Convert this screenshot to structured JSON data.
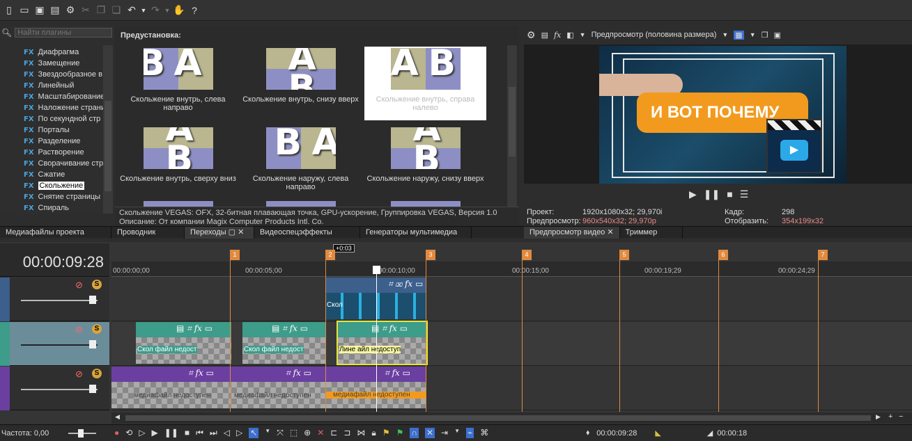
{
  "plugins": {
    "search_placeholder": "Найти плагины",
    "items": [
      "Диафрагма",
      "Замещение",
      "Звездообразное в",
      "Линейный",
      "Масштабирование",
      "Наложение страни",
      "По секундной стр",
      "Порталы",
      "Разделение",
      "Растворение",
      "Сворачивание стр",
      "Сжатие",
      "Скольжение",
      "Снятие страницы",
      "Спираль"
    ],
    "selected": "Скольжение"
  },
  "presets": {
    "header": "Предустановка:",
    "items": [
      {
        "label": "Скольжение внутрь, слева направо",
        "letters": "BA"
      },
      {
        "label": "Скольжение внутрь, снизу вверх",
        "letters": "AB"
      },
      {
        "label": "Скольжение внутрь, справа налево",
        "letters": "AB"
      },
      {
        "label": "Скольжение внутрь, сверху вниз",
        "letters": "AB"
      },
      {
        "label": "Скольжение наружу, слева направо",
        "letters": "BA"
      },
      {
        "label": "Скольжение наружу, снизу вверх",
        "letters": "AB"
      }
    ],
    "info_line1": "Скольжение VEGAS: OFX, 32-битная плавающая точка, GPU-ускорение, Группировка VEGAS, Версия 1.0",
    "info_line2": "Описание: От компании Magix Computer Products Intl. Co."
  },
  "left_tabs": [
    "Медиафайлы проекта",
    "Проводник",
    "Переходы",
    "Видеоспецэффекты",
    "Генераторы мультимедиа"
  ],
  "preview": {
    "mode_label": "Предпросмотр (половина размера)",
    "banner_text": "И ВОТ ПОЧЕМУ",
    "project_label": "Проект:",
    "project_value": "1920x1080x32; 29,970i",
    "preview_label": "Предпросмотр:",
    "preview_value": "960x540x32; 29,970p",
    "frame_label": "Кадр:",
    "frame_value": "298",
    "display_label": "Отобразить:",
    "display_value": "354x199x32",
    "tabs": [
      "Предпросмотр видео",
      "Триммер"
    ]
  },
  "timeline": {
    "timecode": "00:00:09:28",
    "ruler": [
      "00:00:00;00",
      "00:00:05;00",
      "00:00:10;00",
      "00:00:15;00",
      "00:00:19;29",
      "00:00:24;29"
    ],
    "markers": [
      "1",
      "2",
      "3",
      "4",
      "5",
      "6",
      "7"
    ],
    "offset_badge": "+0:03",
    "clip_texts": {
      "c1": "Скол",
      "t2a": "Скол файл недост",
      "t2b": "Скол файл недост",
      "t2c": "Лине айл недоступ",
      "t3a": "медиафайл недоступен",
      "t3b": "медиафайл недоступен",
      "t3c": "медиафайл недоступен"
    },
    "rate_label": "Частота: 0,00",
    "bottom_timecode": "00:00:09:28",
    "bottom_timecode2": "00:00:18"
  },
  "colors": {
    "accent": "#e08a40",
    "banner": "#f29a1e",
    "track_teal": "#3d9c8a",
    "track_purple": "#6a3fa0",
    "track_blue": "#3c5f8c"
  }
}
